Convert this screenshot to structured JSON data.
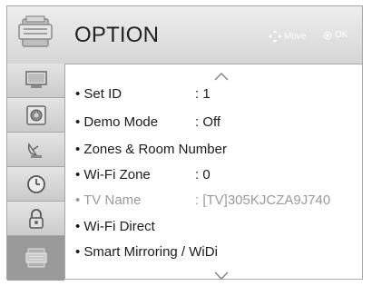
{
  "header": {
    "title": "OPTION",
    "move_hint": "Move",
    "ok_hint": "OK"
  },
  "colors": {
    "header_bg": "#dcdcdc",
    "sidebar_bg": "#d2d2d2",
    "active_tab": "#9a9a9a",
    "text": "#1b1b1b",
    "disabled_text": "#9a9a9a"
  },
  "sidebar": {
    "items": [
      {
        "icon": "picture-icon"
      },
      {
        "icon": "sound-icon"
      },
      {
        "icon": "satellite-dish-icon"
      },
      {
        "icon": "clock-icon"
      },
      {
        "icon": "lock-icon"
      },
      {
        "icon": "option-icon",
        "active": true
      }
    ]
  },
  "menu": {
    "items": [
      {
        "label": "• Set ID",
        "value": ": 1",
        "enabled": true
      },
      {
        "label": "• Demo Mode",
        "value": ": Off",
        "enabled": true
      },
      {
        "label": "• Zones & Room Number",
        "value": "",
        "enabled": true
      },
      {
        "label": "• Wi-Fi Zone",
        "value": ": 0",
        "enabled": true
      },
      {
        "label": "• TV Name",
        "value": ": [TV]305KJCZA9J740",
        "enabled": false
      },
      {
        "label": "• Wi-Fi Direct",
        "value": "",
        "enabled": true
      },
      {
        "label": "• Smart Mirroring / WiDi",
        "value": "",
        "enabled": true
      }
    ]
  }
}
